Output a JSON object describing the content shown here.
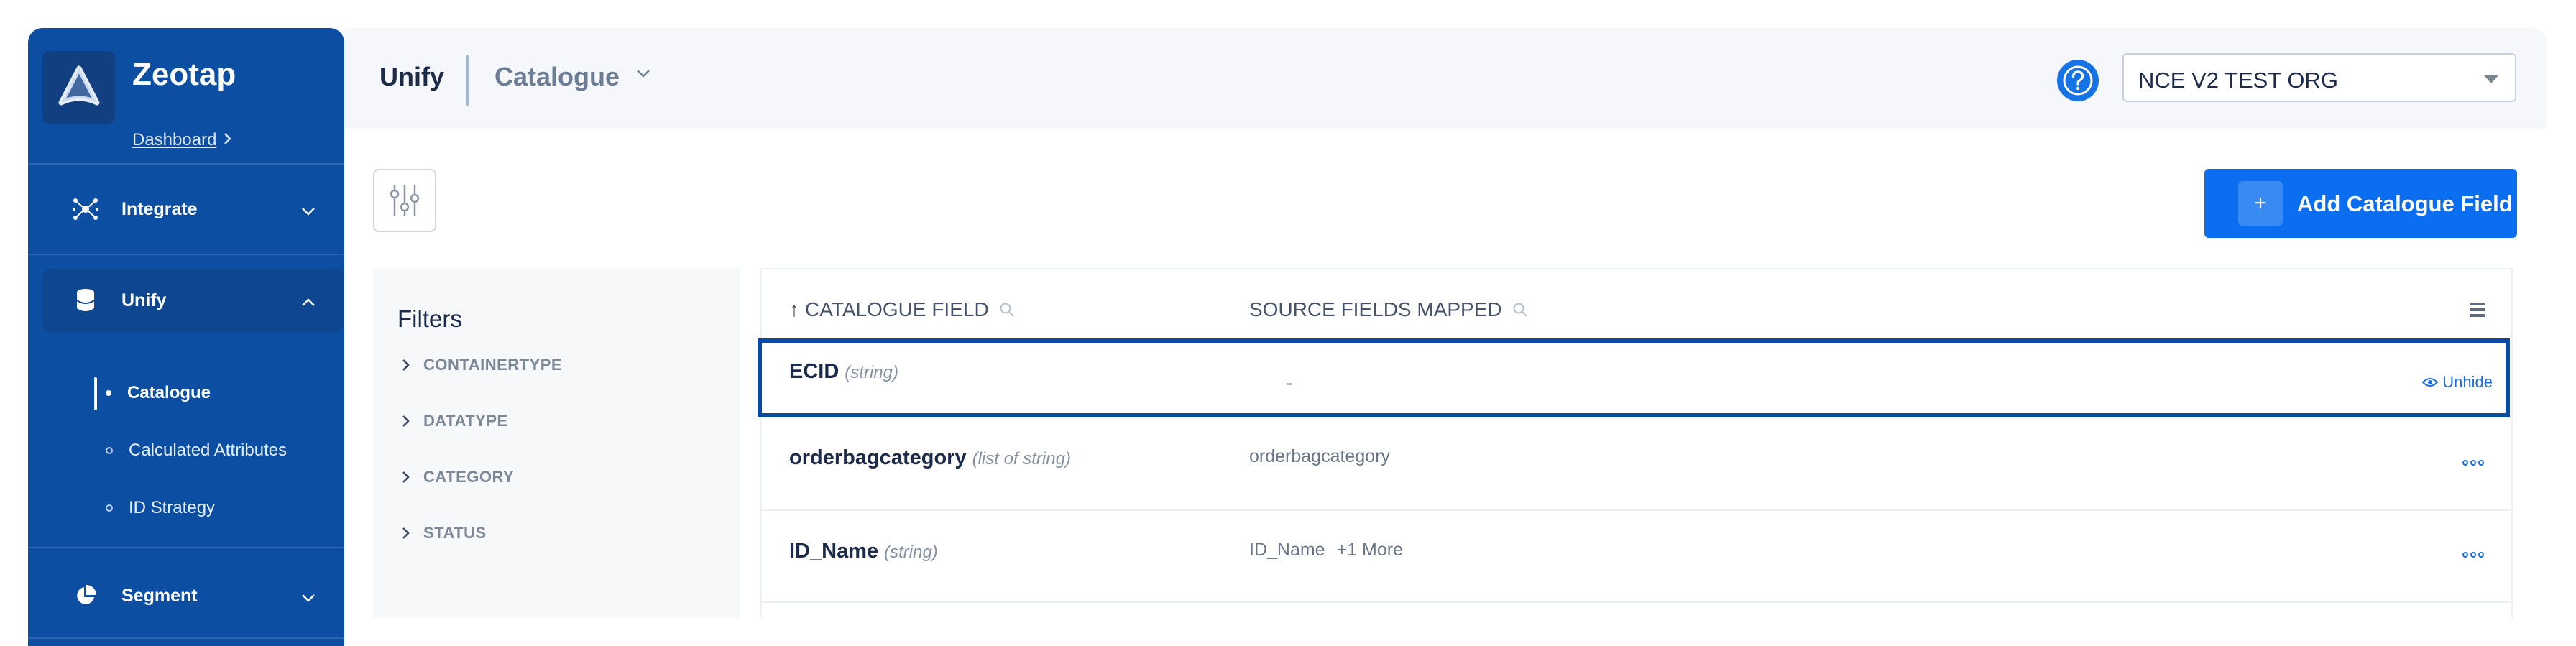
{
  "brand": {
    "name": "Zeotap",
    "dashboard_link": "Dashboard"
  },
  "sidebar": {
    "items": [
      {
        "label": "Integrate",
        "icon": "integrate-icon"
      },
      {
        "label": "Unify",
        "icon": "database-icon"
      },
      {
        "label": "Segment",
        "icon": "pie-chart-icon"
      }
    ],
    "unify_subitems": [
      {
        "label": "Catalogue",
        "active": true
      },
      {
        "label": "Calculated Attributes",
        "active": false
      },
      {
        "label": "ID Strategy",
        "active": false
      }
    ]
  },
  "header": {
    "title": "Unify",
    "section": "Catalogue",
    "org": "NCE V2 TEST ORG"
  },
  "toolbar": {
    "add_label": "Add Catalogue Field",
    "add_plus": "+"
  },
  "filters": {
    "title": "Filters",
    "items": [
      "CONTAINERTYPE",
      "DATATYPE",
      "CATEGORY",
      "STATUS"
    ]
  },
  "table": {
    "columns": [
      "CATALOGUE FIELD",
      "SOURCE FIELDS MAPPED"
    ],
    "sort_arrow": "↑",
    "rows": [
      {
        "name": "ECID",
        "type": "(string)",
        "source": "-",
        "more": "",
        "action": "Unhide"
      },
      {
        "name": "orderbagcategory",
        "type": "(list of string)",
        "source": "orderbagcategory",
        "more": "",
        "action": ""
      },
      {
        "name": "ID_Name",
        "type": "(string)",
        "source": "ID_Name",
        "more": "+1 More",
        "action": ""
      }
    ]
  },
  "colors": {
    "sidebar": "#0b4ea2",
    "accent": "#0b6ef0",
    "selected_border": "#0a4aa3"
  }
}
